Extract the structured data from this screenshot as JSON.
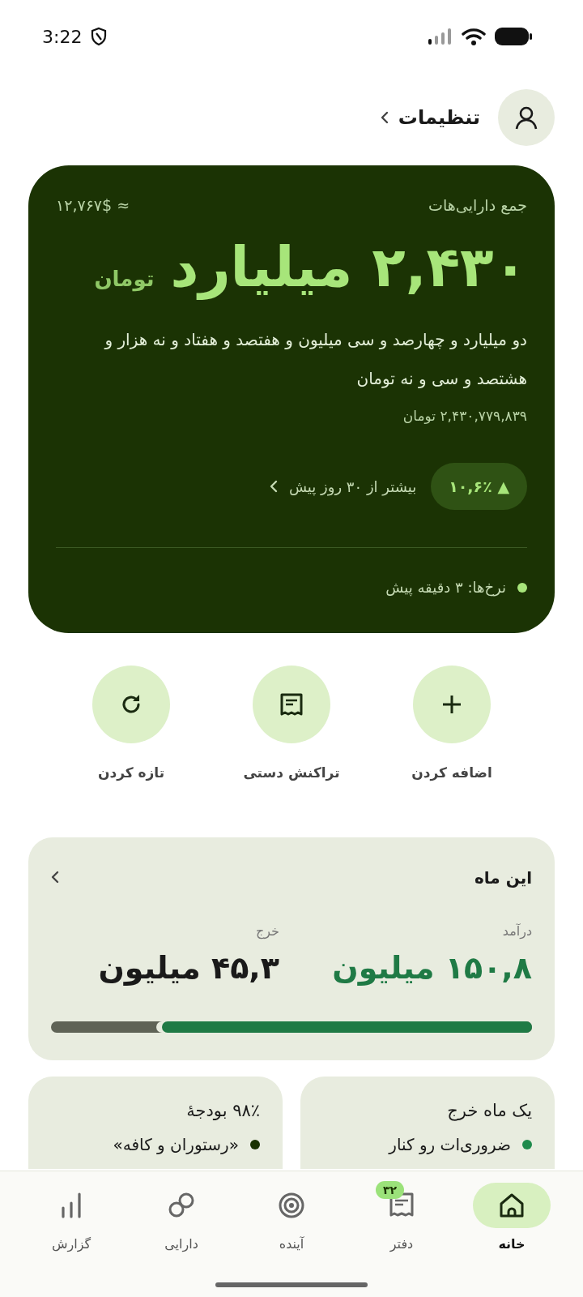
{
  "status_bar": {
    "time": "3:22"
  },
  "header": {
    "settings_label": "تنظیمات"
  },
  "total_card": {
    "title": "جمع دارایی‌هات",
    "usd_estimate": "≈ ۱۲,۷۶۷$",
    "amount": "۲,۴۳۰ میلیارد",
    "currency": "تومان",
    "amount_in_words": "دو میلیارد و چهارصد و سی میلیون و هفتصد و هفتاد و نه هزار و هشتصد و سی و نه تومان",
    "exact_amount": "۲,۴۳۰,۷۷۹,۸۳۹ تومان",
    "change": "▲ ۱۰,۶٪",
    "change_caption": "بیشتر از ۳۰ روز پیش",
    "rates_updated": "نرخ‌ها: ۳ دقیقه پیش"
  },
  "actions": [
    {
      "kind": "add",
      "label": "اضافه کردن"
    },
    {
      "kind": "manual",
      "label": "تراکنش دستی"
    },
    {
      "kind": "refresh",
      "label": "تازه کردن"
    }
  ],
  "month_card": {
    "title": "این ماه",
    "income": {
      "label": "درآمد",
      "value": "۱۵۰,۸ میلیون"
    },
    "expense": {
      "label": "خرج",
      "value": "۴۵,۳ میلیون"
    },
    "level": 0.77
  },
  "mini_cards": [
    {
      "title": "یک ماه خرج",
      "item": "ضروری‌ات رو کنار",
      "color": "#1f8a4c"
    },
    {
      "title": "۹۸٪ بودجهٔ",
      "item": "«رستوران و کافه»",
      "color": "#1a3300"
    }
  ],
  "nav": [
    {
      "kind": "home",
      "label": "خانه",
      "selected": true
    },
    {
      "kind": "ledger",
      "label": "دفتر",
      "selected": false,
      "badge": "۳۲"
    },
    {
      "kind": "future",
      "label": "آینده",
      "selected": false
    },
    {
      "kind": "assets",
      "label": "دارایی",
      "selected": false
    },
    {
      "kind": "report",
      "label": "گزارش",
      "selected": false
    }
  ]
}
